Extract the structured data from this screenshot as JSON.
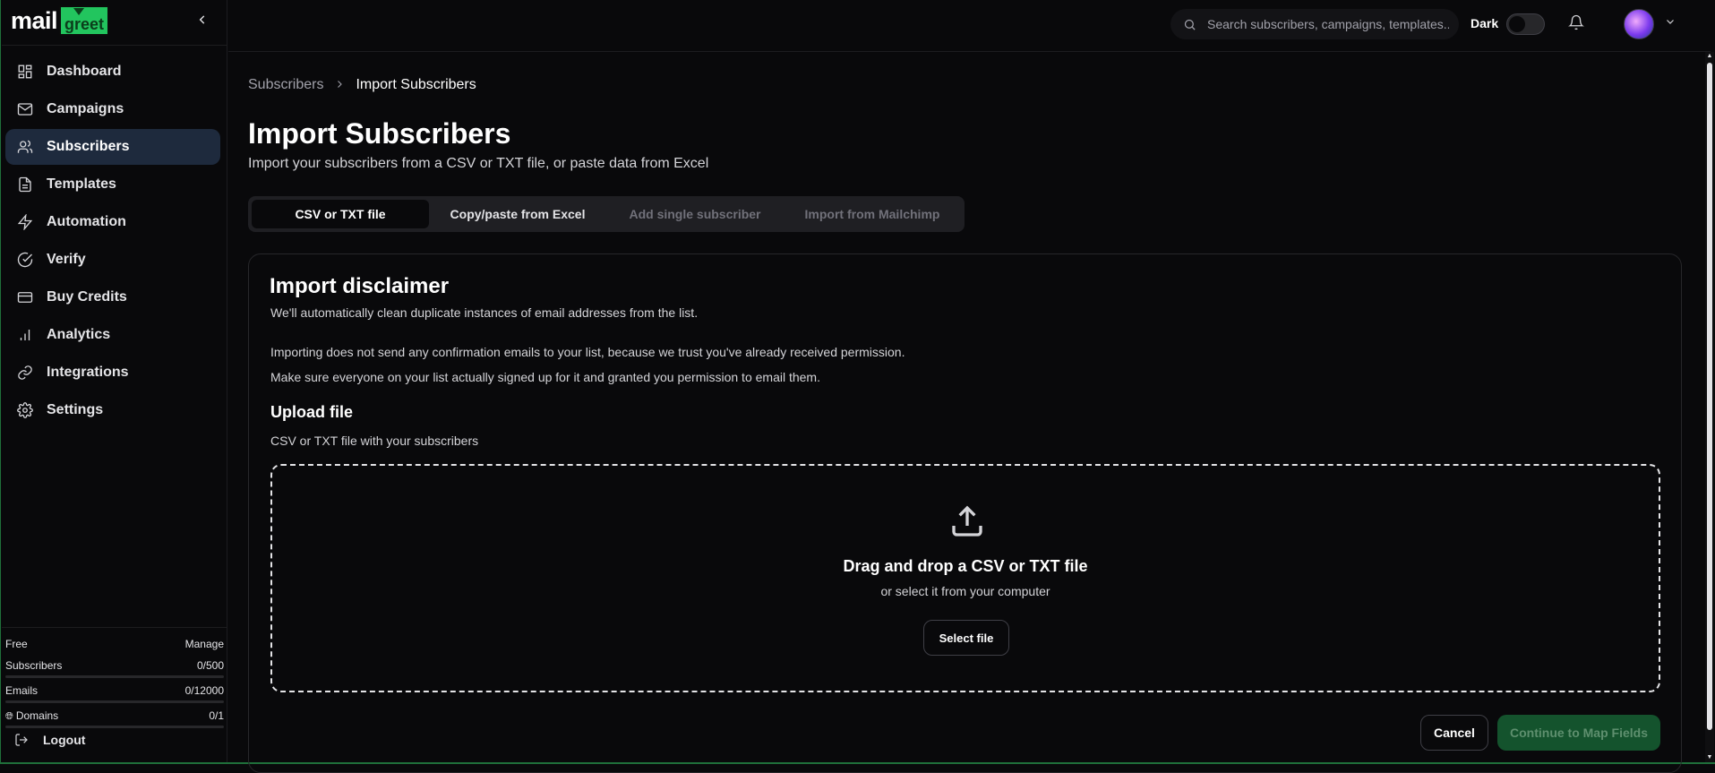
{
  "brand": {
    "part1": "mail",
    "part2": "greet"
  },
  "sidebar": {
    "items": [
      {
        "label": "Dashboard",
        "icon": "dashboard-icon"
      },
      {
        "label": "Campaigns",
        "icon": "mail-icon"
      },
      {
        "label": "Subscribers",
        "icon": "users-icon",
        "active": true
      },
      {
        "label": "Templates",
        "icon": "file-icon"
      },
      {
        "label": "Automation",
        "icon": "zap-icon"
      },
      {
        "label": "Verify",
        "icon": "check-circle-icon"
      },
      {
        "label": "Buy Credits",
        "icon": "credit-card-icon"
      },
      {
        "label": "Analytics",
        "icon": "bar-chart-icon"
      },
      {
        "label": "Integrations",
        "icon": "link-icon"
      },
      {
        "label": "Settings",
        "icon": "gear-icon"
      }
    ],
    "plan": {
      "name": "Free",
      "manage": "Manage"
    },
    "usage": [
      {
        "label": "Subscribers",
        "value": "0/500",
        "fraction": 0
      },
      {
        "label": "Emails",
        "value": "0/12000",
        "fraction": 0
      },
      {
        "label": "Domains",
        "value": "0/1",
        "fraction": 0
      }
    ],
    "logout": "Logout"
  },
  "header": {
    "search_placeholder": "Search subscribers, campaigns, templates...",
    "theme_label": "Dark",
    "theme_on": false
  },
  "breadcrumb": {
    "parent": "Subscribers",
    "current": "Import Subscribers"
  },
  "page": {
    "title": "Import Subscribers",
    "subtitle": "Import your subscribers from a CSV or TXT file, or paste data from Excel"
  },
  "tabs": [
    {
      "label": "CSV or TXT file",
      "state": "active"
    },
    {
      "label": "Copy/paste from Excel",
      "state": "normal"
    },
    {
      "label": "Add single subscriber",
      "state": "muted"
    },
    {
      "label": "Import from Mailchimp",
      "state": "muted"
    }
  ],
  "disclaimer": {
    "title": "Import disclaimer",
    "line1": "We'll automatically clean duplicate instances of email addresses from the list.",
    "line2": "Importing does not send any confirmation emails to your list, because we trust you've already received permission.",
    "line3": "Make sure everyone on your list actually signed up for it and granted you permission to email them."
  },
  "upload": {
    "title": "Upload file",
    "subtitle": "CSV or TXT file with your subscribers",
    "drop_title": "Drag and drop a CSV or TXT file",
    "drop_sub": "or select it from your computer",
    "select_label": "Select file"
  },
  "actions": {
    "cancel": "Cancel",
    "continue": "Continue to Map Fields"
  }
}
